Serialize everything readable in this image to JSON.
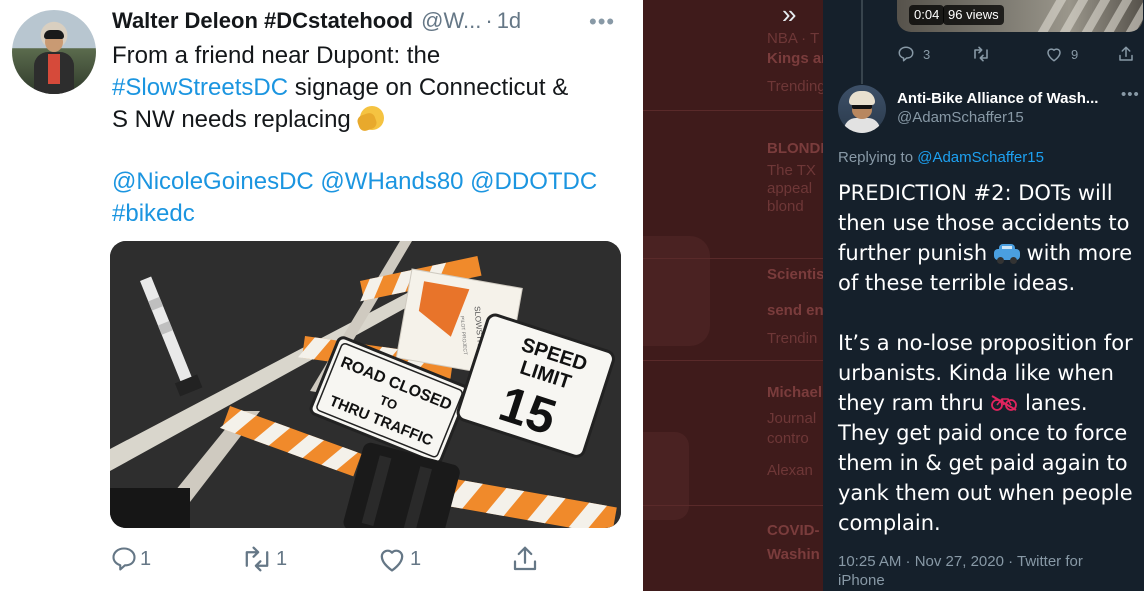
{
  "left_tweet": {
    "display_name": "Walter Deleon #DCstatehood",
    "handle": "@W...",
    "separator": "·",
    "age": "1d",
    "more": "•••",
    "text_line1": "From a friend near Dupont: the",
    "hashtag_slowstreets": "#SlowStreetsDC",
    "text_line2_rest": " signage on Connecticut &",
    "text_line3": "S NW needs replacing ",
    "mentions_line": "@NicoleGoinesDC @WHands80 @DDOTDC",
    "hashtag_bikedc": "#bikedc",
    "photo": {
      "sign_road_closed_1": "ROAD CLOSED",
      "sign_road_closed_2": "TO",
      "sign_road_closed_3": "THRU TRAFFIC",
      "sign_speed_1": "SPEED",
      "sign_speed_2": "LIMIT",
      "sign_speed_value": "15",
      "sign_slowstreets": "SLOWSTREETS",
      "sign_pilot": "PILOT PROJECT"
    },
    "actions": {
      "reply_count": "1",
      "retweet_count": "1",
      "like_count": "1"
    }
  },
  "middle_background": {
    "chevron": "»",
    "lines": [
      {
        "text": "NBA · T",
        "bold": false
      },
      {
        "text": "Kings an",
        "bold": true
      },
      {
        "text": "Trending",
        "bold": false
      },
      {
        "text": "BLONDIE",
        "bold": true
      },
      {
        "text": "The TX",
        "bold": false
      },
      {
        "text": "appeal",
        "bold": false
      },
      {
        "text": "blond",
        "bold": false
      },
      {
        "text": "Scientis",
        "bold": true
      },
      {
        "text": "send en",
        "bold": true
      },
      {
        "text": "Trendin",
        "bold": false
      },
      {
        "text": "Michael",
        "bold": true
      },
      {
        "text": "Journal",
        "bold": false
      },
      {
        "text": "contro",
        "bold": false
      },
      {
        "text": "Alexan",
        "bold": false
      },
      {
        "text": "COVID-",
        "bold": true
      },
      {
        "text": "Washin",
        "bold": true
      }
    ]
  },
  "right_tweet": {
    "video_time": "0:04",
    "video_views": "96 views",
    "prev_actions": {
      "reply_count": "3",
      "like_count": "9"
    },
    "display_name": "Anti-Bike Alliance of Wash...",
    "handle": "@AdamSchaffer15",
    "more": "•••",
    "replying_prefix": "Replying to ",
    "replying_to": "@AdamSchaffer15",
    "para1_a": "PREDICTION #2: DOTs will then use those accidents to further punish ",
    "para1_b": " with more of these terrible ideas.",
    "para2_a": "It’s a no-lose proposition for urbanists. Kinda like when they ram thru ",
    "para2_b": " lanes. They get paid once to force them in & get paid again to yank them out when people complain.",
    "timestamp": "10:25 AM · Nov 27, 2020 · Twitter for iPhone"
  },
  "colors": {
    "link_light": "#1b95e0",
    "link_dark": "#1da1f2",
    "dark_bg": "#15202b",
    "dim_bg": "#3f1b1b"
  },
  "icons": [
    "more-icon",
    "facepalm-emoji-icon",
    "reply-icon",
    "retweet-icon",
    "like-icon",
    "share-icon",
    "chevron-double-right-icon",
    "car-emoji-icon",
    "no-bicycle-emoji-icon"
  ]
}
